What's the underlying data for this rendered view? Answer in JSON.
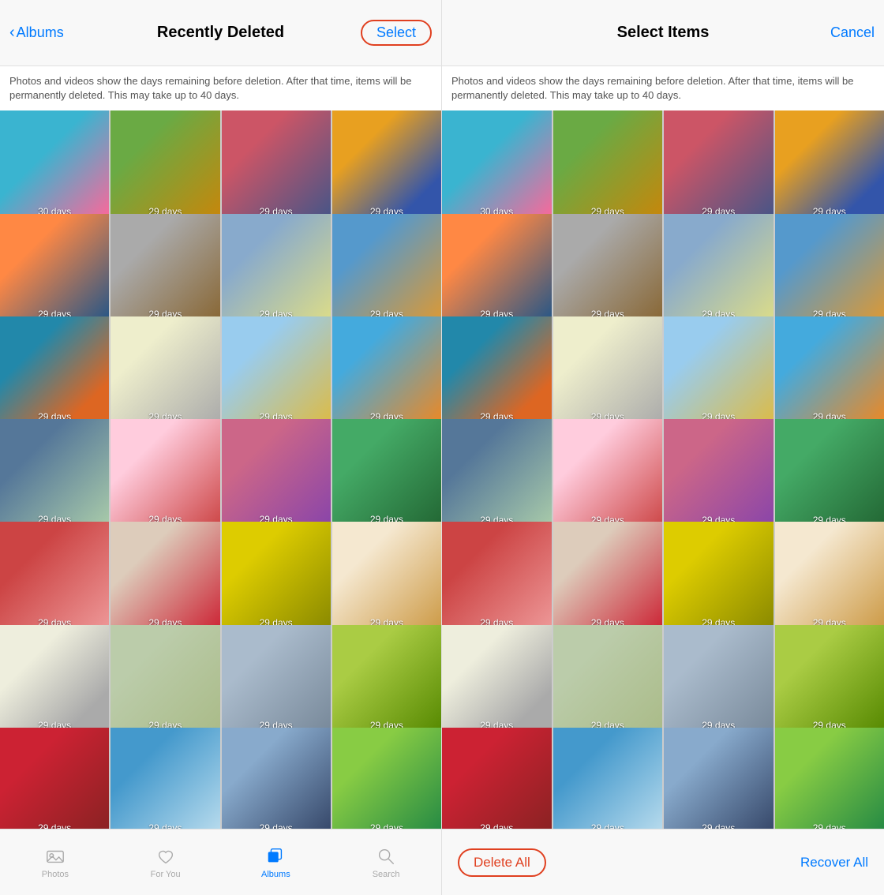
{
  "left_screen": {
    "header": {
      "back_label": "Albums",
      "title": "Recently Deleted",
      "select_label": "Select"
    },
    "info_text": "Photos and videos show the days remaining before deletion. After that time, items will be permanently deleted. This may take up to 40 days.",
    "photos": [
      {
        "days": "30 days"
      },
      {
        "days": "29 days"
      },
      {
        "days": "29 days"
      },
      {
        "days": "29 days"
      },
      {
        "days": "29 days"
      },
      {
        "days": "29 days"
      },
      {
        "days": "29 days"
      },
      {
        "days": "29 days"
      },
      {
        "days": "29 days"
      },
      {
        "days": "29 days"
      },
      {
        "days": "29 days"
      },
      {
        "days": "29 days"
      },
      {
        "days": "29 days"
      },
      {
        "days": "29 days"
      },
      {
        "days": "29 days"
      },
      {
        "days": "29 days"
      },
      {
        "days": "29 days"
      },
      {
        "days": "29 days"
      },
      {
        "days": "29 days"
      },
      {
        "days": "29 days"
      },
      {
        "days": "29 days"
      },
      {
        "days": "29 days"
      },
      {
        "days": "29 days"
      },
      {
        "days": "29 days"
      },
      {
        "days": "29 days"
      },
      {
        "days": "29 days"
      },
      {
        "days": "29 days"
      },
      {
        "days": "29 days"
      }
    ],
    "tabs": [
      {
        "label": "Photos",
        "icon": "photos-icon",
        "active": false
      },
      {
        "label": "For You",
        "icon": "foryou-icon",
        "active": false
      },
      {
        "label": "Albums",
        "icon": "albums-icon",
        "active": true
      },
      {
        "label": "Search",
        "icon": "search-icon",
        "active": false
      }
    ]
  },
  "right_screen": {
    "header": {
      "title": "Select Items",
      "cancel_label": "Cancel"
    },
    "info_text": "Photos and videos show the days remaining before deletion. After that time, items will be permanently deleted. This may take up to 40 days.",
    "photos": [
      {
        "days": "30 days"
      },
      {
        "days": "29 days"
      },
      {
        "days": "29 days"
      },
      {
        "days": "29 days"
      },
      {
        "days": "29 days"
      },
      {
        "days": "29 days"
      },
      {
        "days": "29 days"
      },
      {
        "days": "29 days"
      },
      {
        "days": "29 days"
      },
      {
        "days": "29 days"
      },
      {
        "days": "29 days"
      },
      {
        "days": "29 days"
      },
      {
        "days": "29 days"
      },
      {
        "days": "29 days"
      },
      {
        "days": "29 days"
      },
      {
        "days": "29 days"
      },
      {
        "days": "29 days"
      },
      {
        "days": "29 days"
      },
      {
        "days": "29 days"
      },
      {
        "days": "29 days"
      },
      {
        "days": "29 days"
      },
      {
        "days": "29 days"
      },
      {
        "days": "29 days"
      },
      {
        "days": "29 days"
      },
      {
        "days": "29 days"
      },
      {
        "days": "29 days"
      },
      {
        "days": "29 days"
      },
      {
        "days": "29 days"
      }
    ],
    "action_bar": {
      "delete_all_label": "Delete All",
      "recover_all_label": "Recover All"
    }
  },
  "colors": {
    "accent": "#007aff",
    "destructive": "#e04020",
    "tab_active": "#007aff",
    "tab_inactive": "#aaaaaa"
  }
}
